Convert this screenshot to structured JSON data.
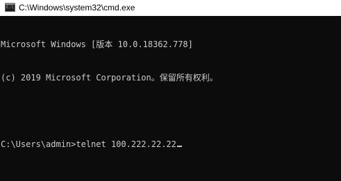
{
  "window": {
    "title": "C:\\Windows\\system32\\cmd.exe",
    "icon": "cmd-console-icon",
    "icon_prompt": "C:\\"
  },
  "console": {
    "lines": [
      "Microsoft Windows [版本 10.0.18362.778]",
      "(c) 2019 Microsoft Corporation。保留所有权利。",
      "",
      "C:\\Users\\admin>telnet 100.222.22.22"
    ],
    "background_color": "#0c0c0c",
    "text_color": "#cccccc"
  }
}
